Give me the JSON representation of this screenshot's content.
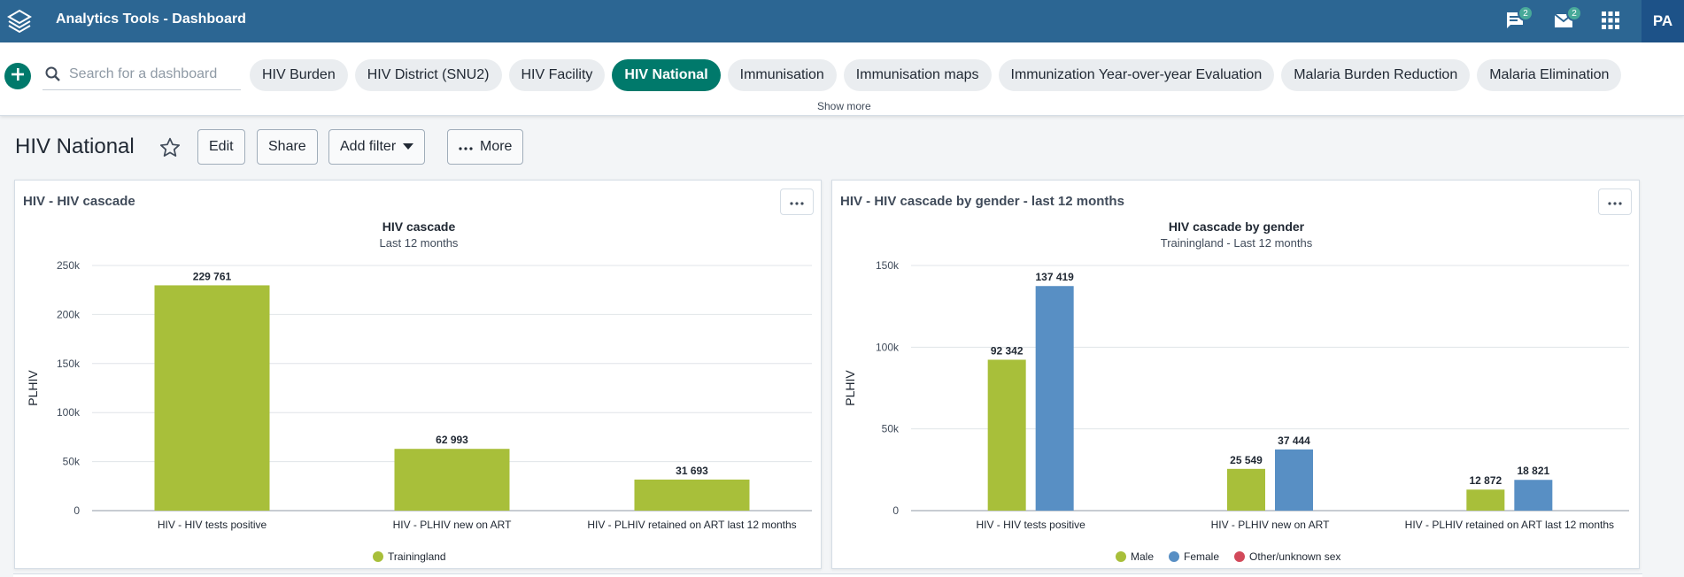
{
  "header": {
    "app_title": "Analytics Tools - Dashboard",
    "messages_icon": "chat-bubble-icon",
    "messages_count": "2",
    "mail_icon": "mail-icon",
    "mail_count": "2",
    "apps_icon": "grid-apps-icon",
    "profile_initials": "PA",
    "bar_color": "#2c6693"
  },
  "controlbar": {
    "search_placeholder": "Search for a dashboard",
    "chips": [
      "HIV Burden",
      "HIV District (SNU2)",
      "HIV Facility",
      "HIV National",
      "Immunisation",
      "Immunisation maps",
      "Immunization Year-over-year Evaluation",
      "Malaria Burden Reduction",
      "Malaria Elimination"
    ],
    "selected_chip": "HIV National",
    "show_more": "Show more",
    "accent_color": "#00796b"
  },
  "titlebar": {
    "title": "HIV National",
    "edit": "Edit",
    "share": "Share",
    "add_filter": "Add filter",
    "more": "More"
  },
  "panels": [
    {
      "title": "HIV - HIV cascade",
      "chart_data": {
        "type": "bar",
        "title": "HIV cascade",
        "subtitle": "Last 12 months",
        "ylabel": "PLHIV",
        "categories": [
          "HIV - HIV tests positive",
          "HIV - PLHIV new on ART",
          "HIV - PLHIV retained on ART last 12 months"
        ],
        "series": [
          {
            "name": "Trainingland",
            "color": "#a8bf3a",
            "values": [
              229761,
              62993,
              31693
            ],
            "labels": [
              "229 761",
              "62 993",
              "31 693"
            ]
          }
        ],
        "ylim": [
          0,
          250000
        ],
        "yticks": [
          0,
          50000,
          100000,
          150000,
          200000,
          250000
        ],
        "ytick_labels": [
          "0",
          "50k",
          "100k",
          "150k",
          "200k",
          "250k"
        ],
        "grid": true,
        "legend": "bottom-center"
      }
    },
    {
      "title": "HIV - HIV cascade by gender - last 12 months",
      "chart_data": {
        "type": "bar",
        "title": "HIV cascade by gender",
        "subtitle": "Trainingland - Last 12 months",
        "ylabel": "PLHIV",
        "categories": [
          "HIV - HIV tests positive",
          "HIV - PLHIV new on ART",
          "HIV - PLHIV retained on ART last 12 months"
        ],
        "series": [
          {
            "name": "Male",
            "color": "#a8bf3a",
            "values": [
              92342,
              25549,
              12872
            ],
            "labels": [
              "92 342",
              "25 549",
              "12 872"
            ]
          },
          {
            "name": "Female",
            "color": "#588fc4",
            "values": [
              137419,
              37444,
              18821
            ],
            "labels": [
              "137 419",
              "37 444",
              "18 821"
            ]
          },
          {
            "name": "Other/unknown sex",
            "color": "#d2495a",
            "values": [
              0,
              0,
              0
            ],
            "labels": [
              "",
              "",
              ""
            ]
          }
        ],
        "ylim": [
          0,
          150000
        ],
        "yticks": [
          0,
          50000,
          100000,
          150000
        ],
        "ytick_labels": [
          "0",
          "50k",
          "100k",
          "150k"
        ],
        "grid": true,
        "legend": "bottom-center"
      }
    }
  ]
}
